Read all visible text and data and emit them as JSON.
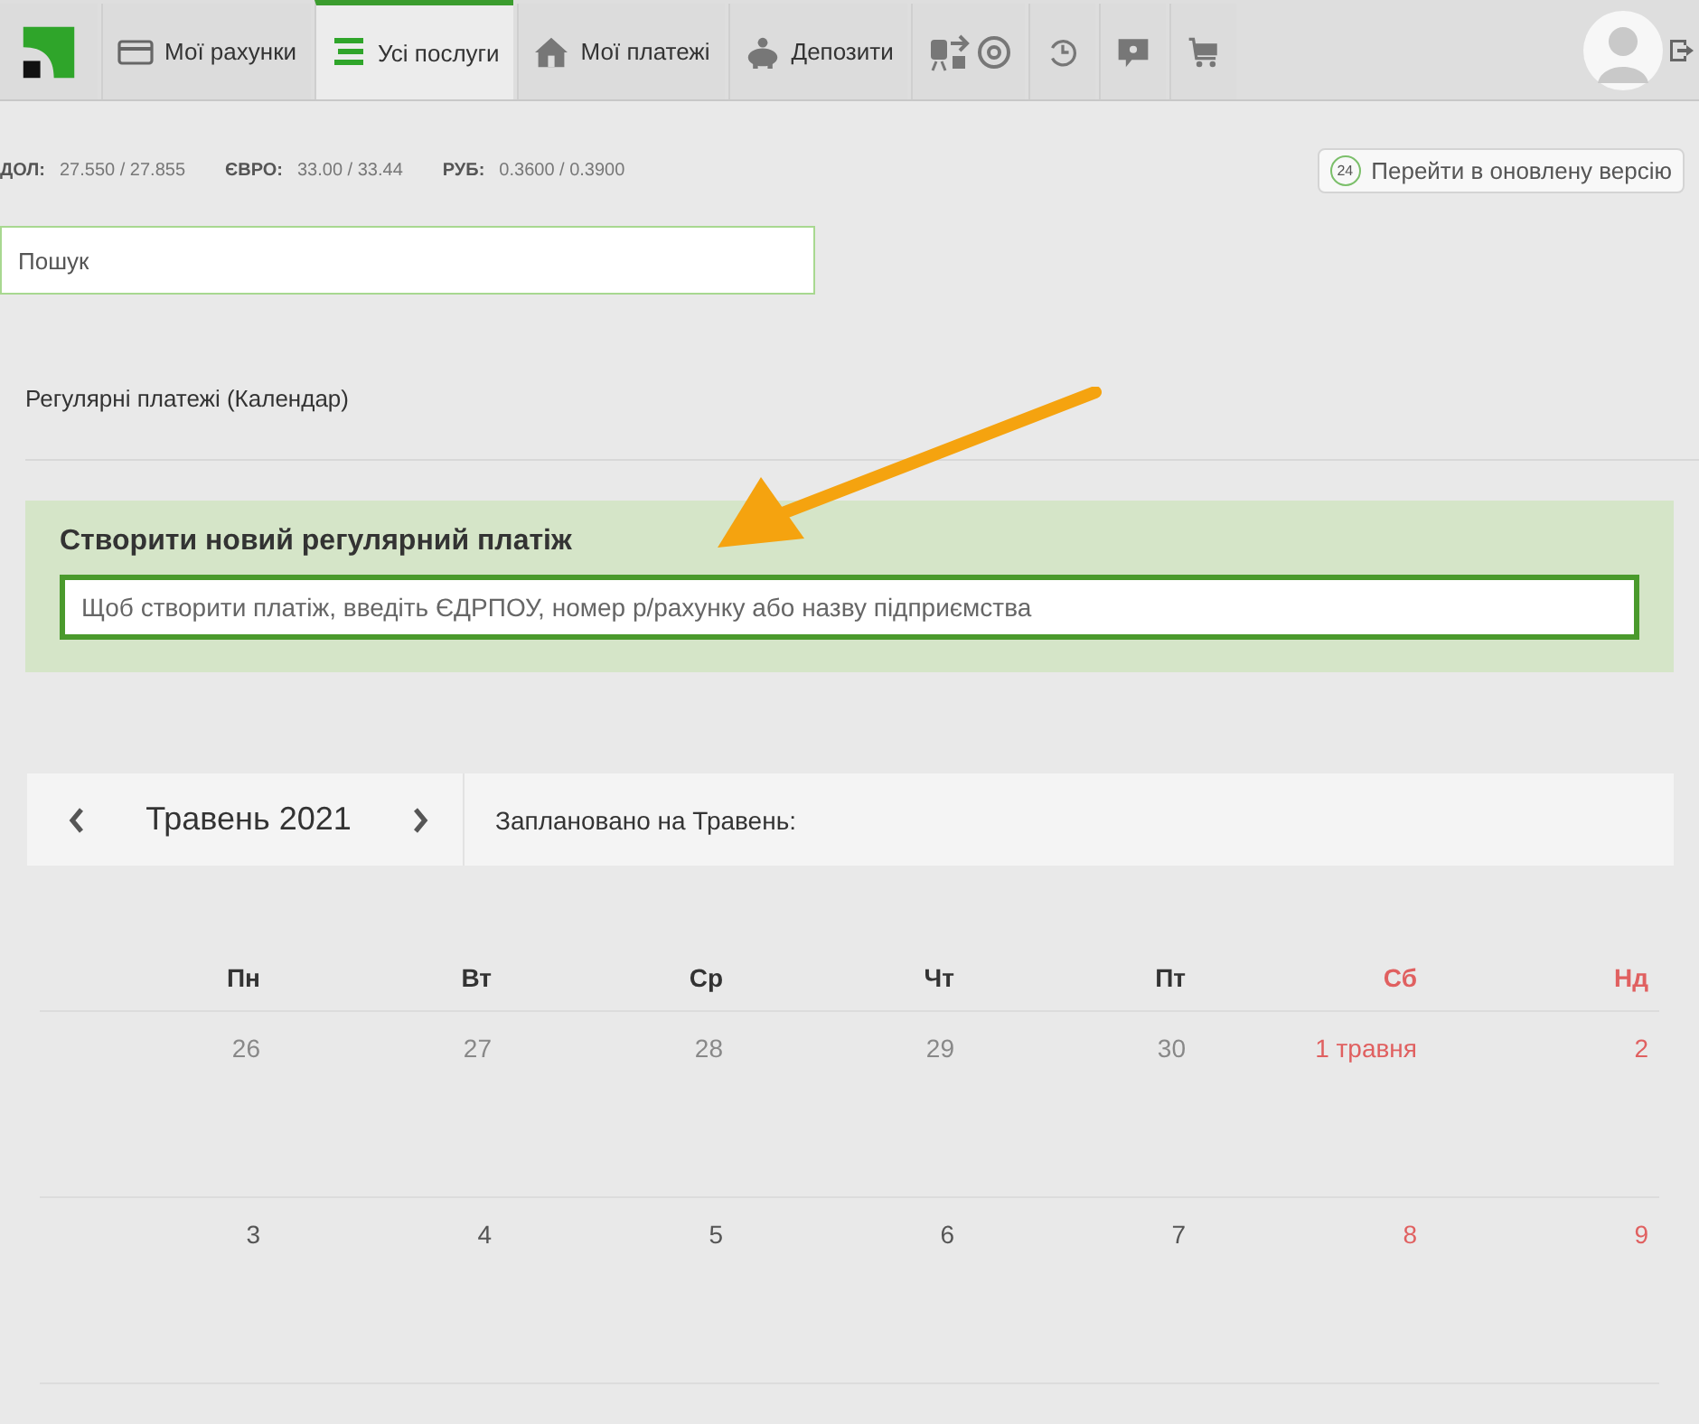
{
  "nav": {
    "tabs": [
      {
        "kind": "logo",
        "selected": false
      },
      {
        "kind": "card",
        "label": "Мої рахунки",
        "selected": false
      },
      {
        "kind": "list",
        "label": "Усі послуги",
        "selected": true
      },
      {
        "kind": "house",
        "label": "Мої платежі",
        "selected": false
      },
      {
        "kind": "piggy",
        "label": "Депозити",
        "selected": false
      },
      {
        "kind": "travel",
        "selected": false
      },
      {
        "kind": "clock",
        "selected": false
      },
      {
        "kind": "help",
        "selected": false
      },
      {
        "kind": "cart",
        "selected": false
      }
    ]
  },
  "rates": [
    {
      "currency": "ДОЛ:",
      "value": "27.550 / 27.855"
    },
    {
      "currency": "ЄВРО:",
      "value": "33.00 / 33.44"
    },
    {
      "currency": "РУБ:",
      "value": "0.3600 / 0.3900"
    }
  ],
  "new_version_button": {
    "badge": "24",
    "label": "Перейти в оновлену версію"
  },
  "search": {
    "placeholder": "Пошук"
  },
  "breadcrumb": "Регулярні платежі (Календар)",
  "create_panel": {
    "title": "Створити новий регулярний платіж",
    "placeholder": "Щоб створити платіж, введіть ЄДРПОУ, номер р/рахунку або назву підприємства"
  },
  "calendar": {
    "month": "Травень 2021",
    "planned": "Заплановано на Травень:",
    "weekdays": [
      {
        "label": "Пн",
        "weekend": false
      },
      {
        "label": "Вт",
        "weekend": false
      },
      {
        "label": "Ср",
        "weekend": false
      },
      {
        "label": "Чт",
        "weekend": false
      },
      {
        "label": "Пт",
        "weekend": false
      },
      {
        "label": "Сб",
        "weekend": true
      },
      {
        "label": "Нд",
        "weekend": true
      }
    ],
    "weeks": [
      [
        {
          "label": "26",
          "weekend": false,
          "other_month": true
        },
        {
          "label": "27",
          "weekend": false,
          "other_month": true
        },
        {
          "label": "28",
          "weekend": false,
          "other_month": true
        },
        {
          "label": "29",
          "weekend": false,
          "other_month": true
        },
        {
          "label": "30",
          "weekend": false,
          "other_month": true
        },
        {
          "label": "1 травня",
          "weekend": true,
          "other_month": false
        },
        {
          "label": "2",
          "weekend": true,
          "other_month": false
        }
      ],
      [
        {
          "label": "3",
          "weekend": false,
          "other_month": false
        },
        {
          "label": "4",
          "weekend": false,
          "other_month": false
        },
        {
          "label": "5",
          "weekend": false,
          "other_month": false
        },
        {
          "label": "6",
          "weekend": false,
          "other_month": false
        },
        {
          "label": "7",
          "weekend": false,
          "other_month": false
        },
        {
          "label": "8",
          "weekend": true,
          "other_month": false
        },
        {
          "label": "9",
          "weekend": true,
          "other_month": false
        }
      ]
    ]
  }
}
